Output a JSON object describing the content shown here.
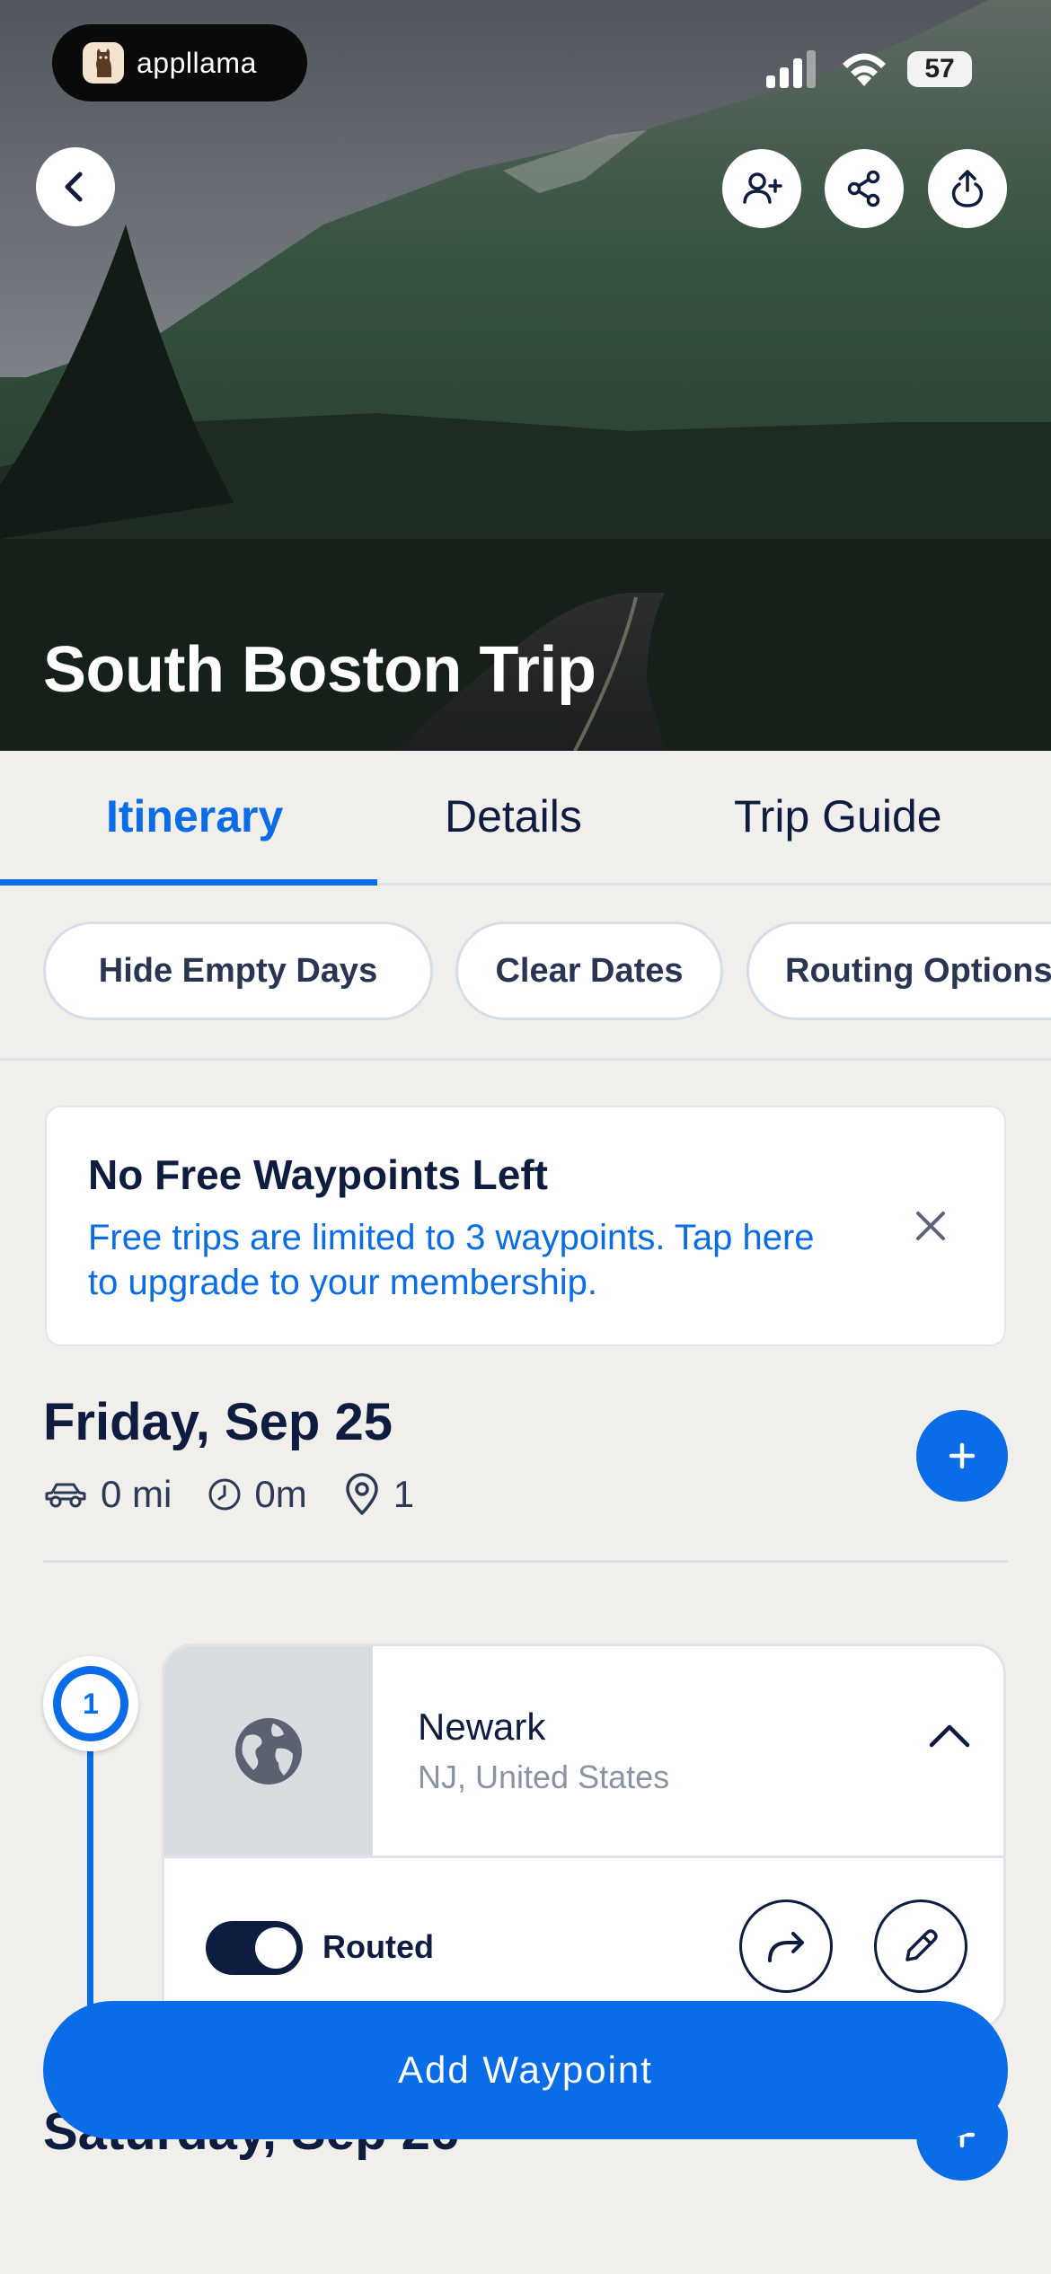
{
  "status_bar": {
    "app_pill_label": "appllama",
    "battery": "57",
    "icons": [
      "signal-icon",
      "wifi-icon",
      "battery-icon"
    ]
  },
  "hero": {
    "trip_title": "South Boston Trip",
    "buttons": [
      "back-icon",
      "add-collaborator-icon",
      "share-network-icon",
      "export-icon"
    ]
  },
  "tabs": [
    {
      "label": "Itinerary",
      "active": true
    },
    {
      "label": "Details",
      "active": false
    },
    {
      "label": "Trip Guide",
      "active": false
    }
  ],
  "chips": [
    "Hide Empty Days",
    "Clear Dates",
    "Routing Options"
  ],
  "banner": {
    "title": "No Free Waypoints Left",
    "body": "Free trips are limited to 3 waypoints. Tap here to upgrade to your membership."
  },
  "days": [
    {
      "title": "Friday, Sep 25",
      "distance": "0 mi",
      "duration": "0m",
      "stops": "1",
      "waypoints": [
        {
          "number": "1",
          "name": "Newark",
          "subtitle": "NJ, United States",
          "routed_label": "Routed",
          "routed": true
        }
      ]
    },
    {
      "title": "Saturday, Sep 26"
    }
  ],
  "cta": {
    "label": "Add Waypoint"
  },
  "colors": {
    "accent": "#0a6ce6",
    "navy": "#0e1c3f",
    "background": "#f1efeb"
  }
}
